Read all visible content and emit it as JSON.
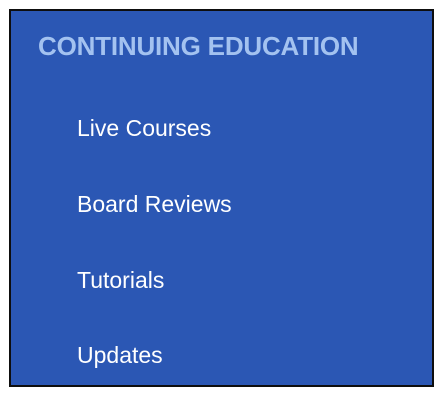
{
  "menu": {
    "title": "CONTINUING EDUCATION",
    "items": [
      {
        "label": "Live Courses"
      },
      {
        "label": "Board Reviews"
      },
      {
        "label": "Tutorials"
      },
      {
        "label": "Updates"
      }
    ]
  },
  "colors": {
    "panel_background": "#2b57b4",
    "title_text": "#a3c2f0",
    "item_text": "#ffffff",
    "border": "#0e0e0e"
  }
}
